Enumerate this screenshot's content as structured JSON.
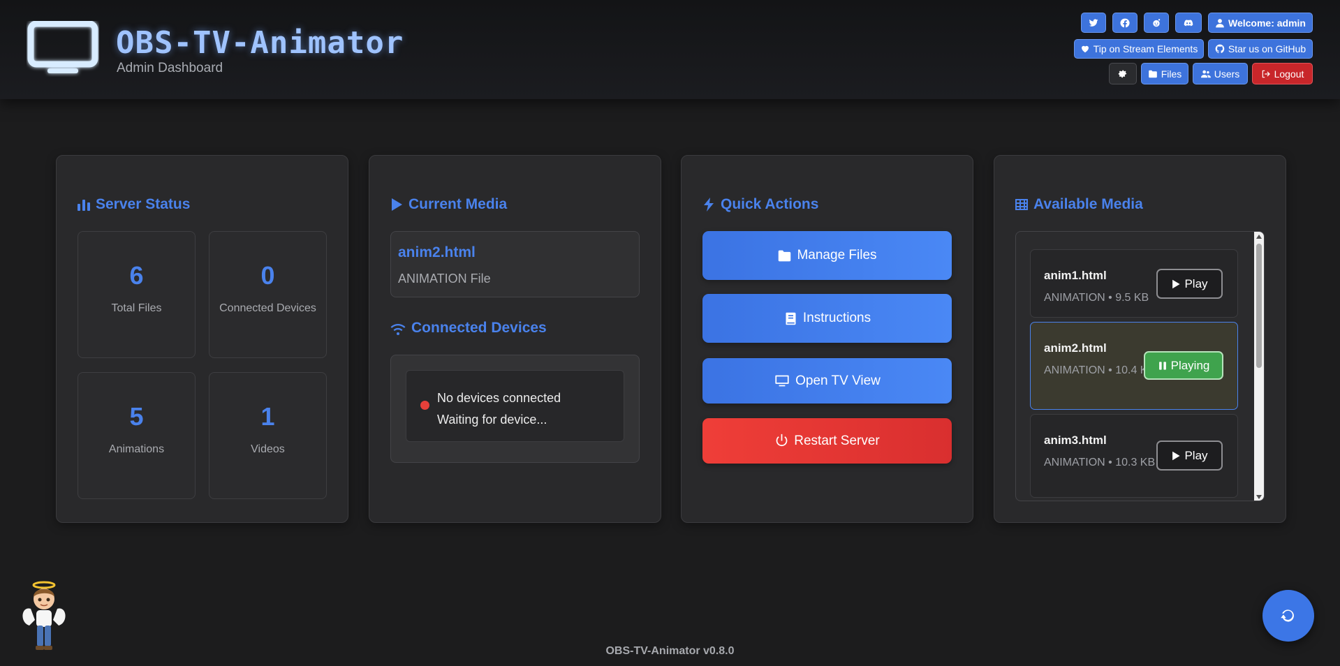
{
  "header": {
    "title": "OBS-TV-Animator",
    "subtitle": "Admin Dashboard",
    "welcome_label": "Welcome: admin",
    "tip_label": "Tip on Stream Elements",
    "github_label": "Star us on GitHub",
    "files_label": "Files",
    "users_label": "Users",
    "logout_label": "Logout",
    "social_icons": [
      "twitter-icon",
      "facebook-icon",
      "reddit-icon",
      "discord-icon"
    ]
  },
  "server_status": {
    "title": "Server Status",
    "stats": [
      {
        "value": "6",
        "label": "Total Files"
      },
      {
        "value": "0",
        "label": "Connected Devices"
      },
      {
        "value": "5",
        "label": "Animations"
      },
      {
        "value": "1",
        "label": "Videos"
      }
    ]
  },
  "current_media": {
    "title": "Current Media",
    "name": "anim2.html",
    "type": "ANIMATION File"
  },
  "connected_devices": {
    "title": "Connected Devices",
    "status_line1": "No devices connected",
    "status_line2": "Waiting for device..."
  },
  "quick_actions": {
    "title": "Quick Actions",
    "manage_files": "Manage Files",
    "instructions": "Instructions",
    "open_tv_view": "Open TV View",
    "restart_server": "Restart Server"
  },
  "available_media": {
    "title": "Available Media",
    "items": [
      {
        "name": "anim1.html",
        "meta": "ANIMATION • 9.5 KB",
        "button": "Play"
      },
      {
        "name": "anim2.html",
        "meta": "ANIMATION • 10.4 KB",
        "button": "Playing"
      },
      {
        "name": "anim3.html",
        "meta": "ANIMATION • 10.3 KB",
        "button": "Play"
      }
    ]
  },
  "footer": {
    "version": "OBS-TV-Animator v0.8.0"
  },
  "colors": {
    "accent": "#4a82ec",
    "danger": "#e8403a",
    "playing": "#3fa34d"
  }
}
